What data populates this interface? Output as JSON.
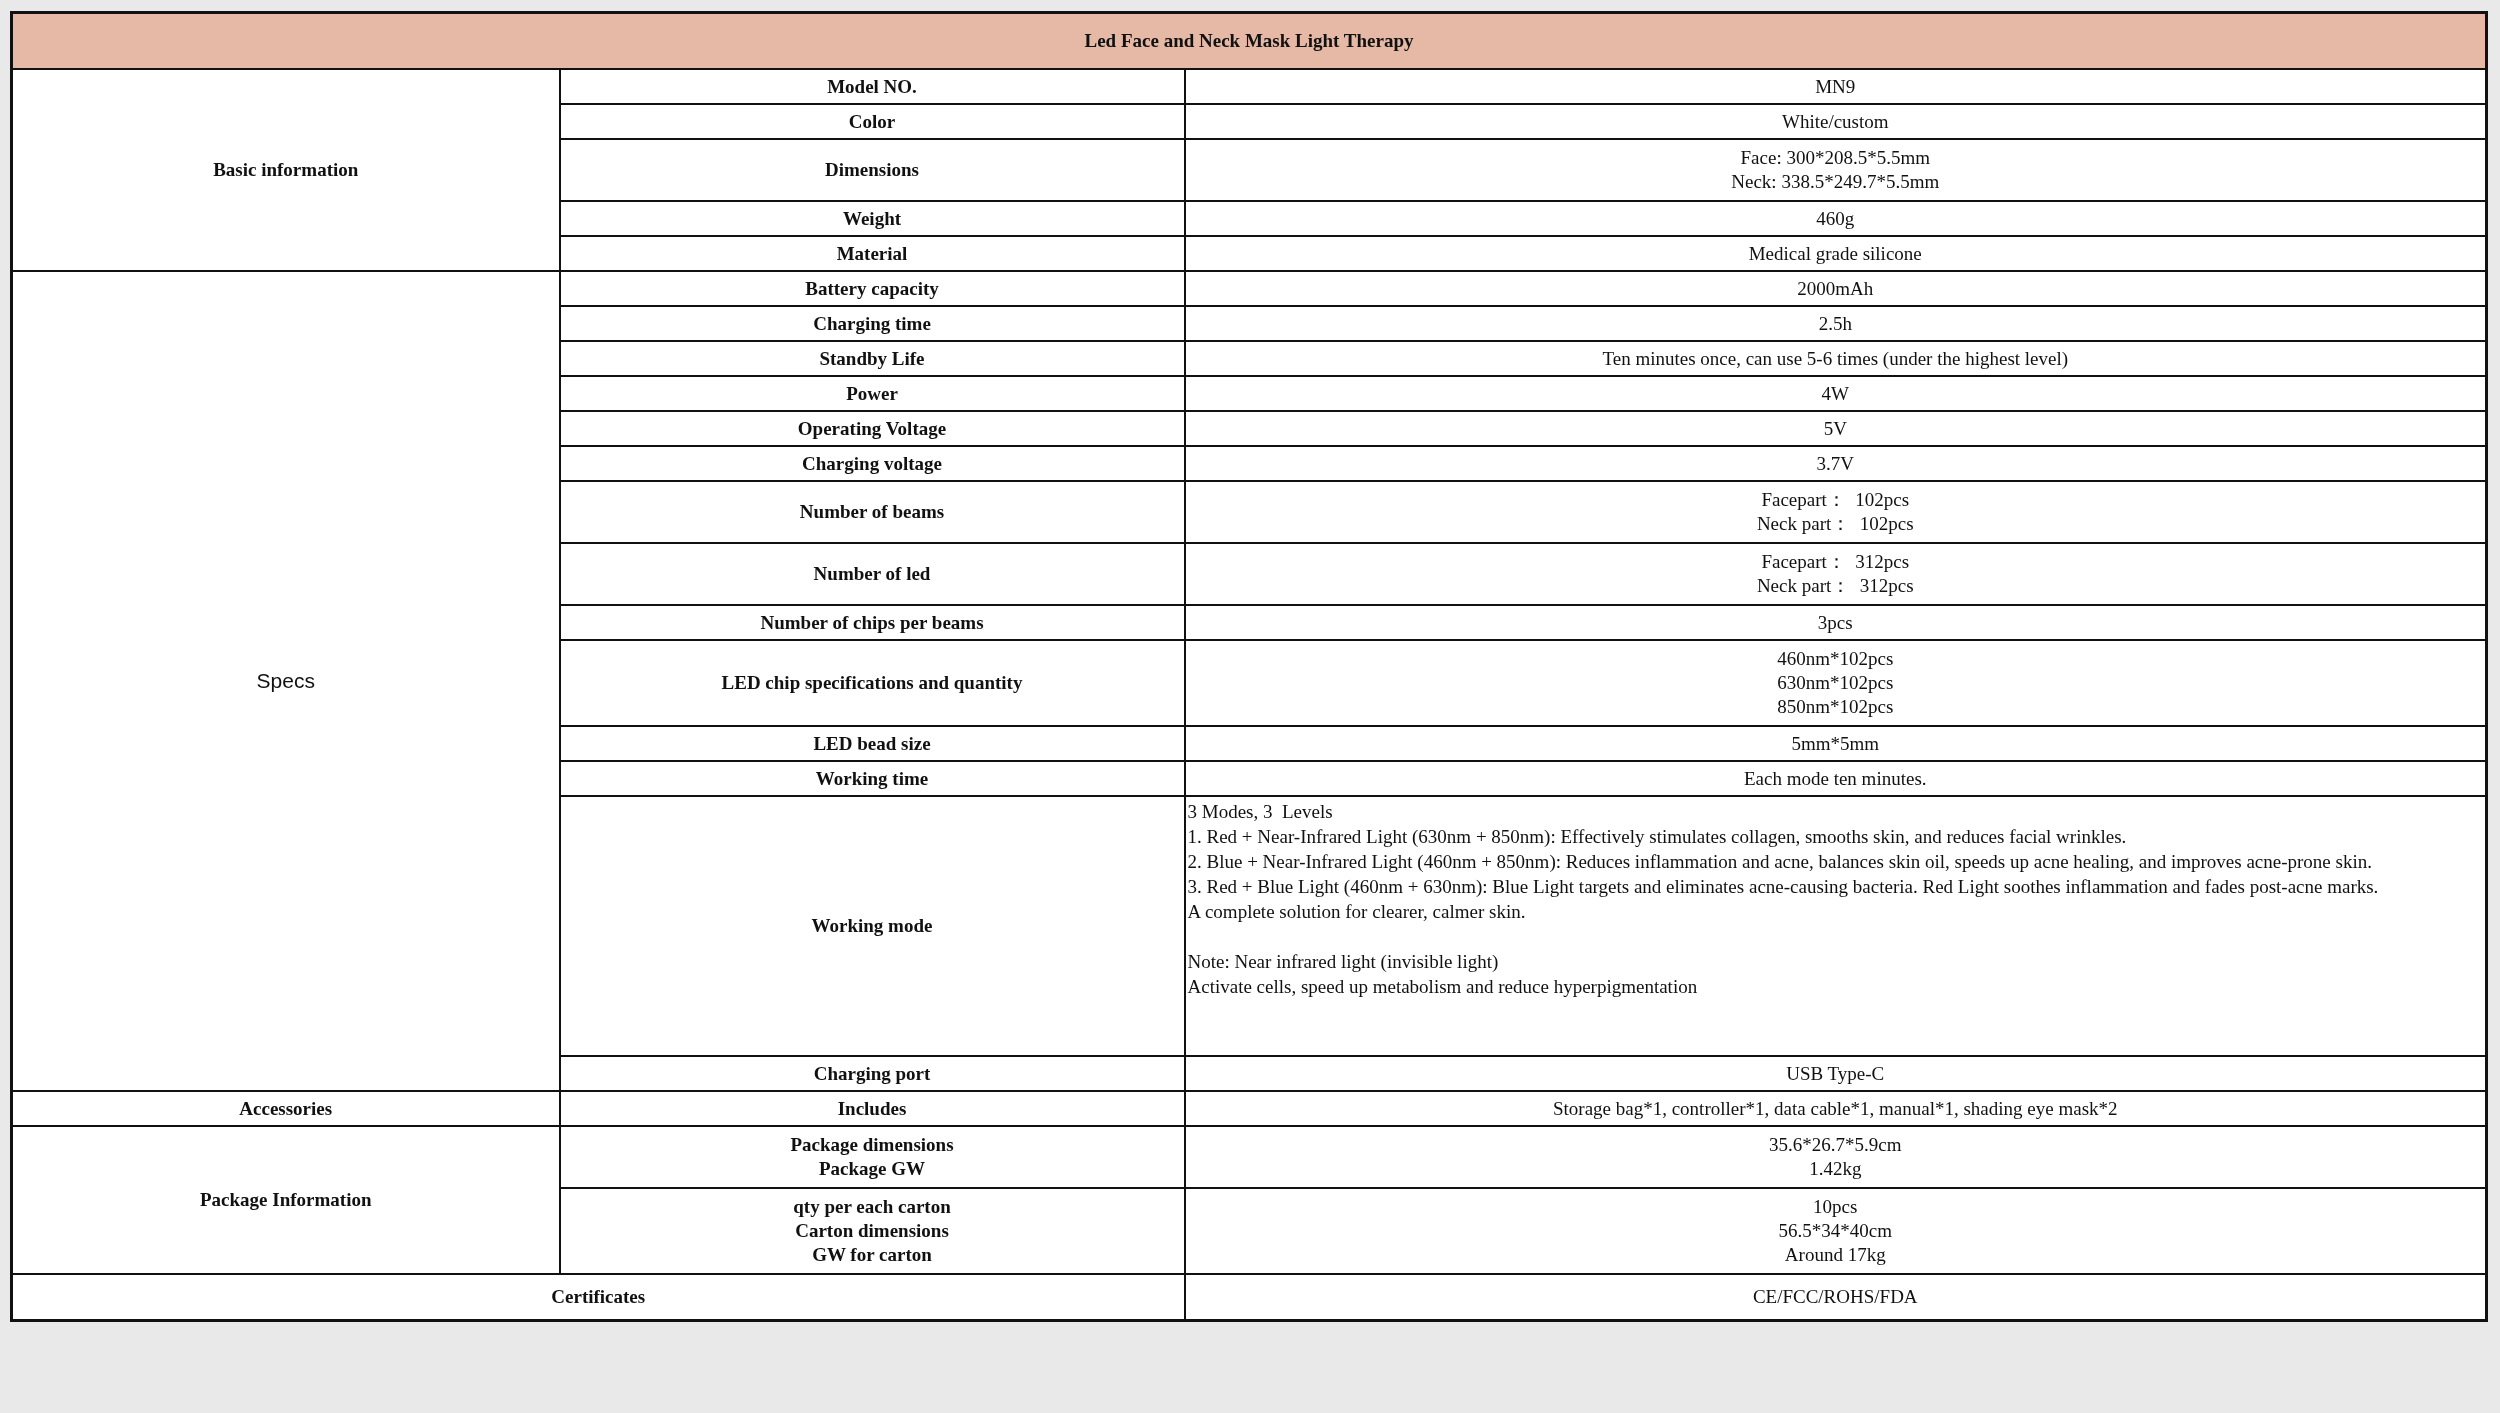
{
  "title": "Led Face and Neck Mask Light Therapy",
  "sections": [
    {
      "label": "Basic information",
      "kind": "bold",
      "rows": [
        {
          "label": [
            "Model NO."
          ],
          "value": [
            "MN9"
          ]
        },
        {
          "label": [
            "Color"
          ],
          "value": [
            "White/custom"
          ]
        },
        {
          "label": [
            "Dimensions"
          ],
          "value": [
            "Face: 300*208.5*5.5mm",
            "Neck: 338.5*249.7*5.5mm"
          ]
        },
        {
          "label": [
            "Weight"
          ],
          "value": [
            "460g"
          ]
        },
        {
          "label": [
            "Material"
          ],
          "value": [
            "Medical grade silicone"
          ]
        }
      ]
    },
    {
      "label": "Specs",
      "kind": "sans",
      "rows": [
        {
          "label": [
            "Battery capacity"
          ],
          "value": [
            "2000mAh"
          ]
        },
        {
          "label": [
            "Charging time"
          ],
          "value": [
            "2.5h"
          ]
        },
        {
          "label": [
            "Standby Life"
          ],
          "value": [
            "Ten minutes once, can use 5-6 times (under the highest level)"
          ]
        },
        {
          "label": [
            "Power"
          ],
          "value": [
            "4W"
          ]
        },
        {
          "label": [
            "Operating Voltage"
          ],
          "value": [
            "5V"
          ]
        },
        {
          "label": [
            "Charging voltage"
          ],
          "value": [
            "3.7V"
          ]
        },
        {
          "label": [
            "Number of beams"
          ],
          "value": [
            "Facepart：  102pcs",
            "Neck part：  102pcs"
          ]
        },
        {
          "label": [
            "Number of led"
          ],
          "value": [
            "Facepart：  312pcs",
            "Neck part：  312pcs"
          ]
        },
        {
          "label": [
            "Number of chips per beams"
          ],
          "value": [
            "3pcs"
          ]
        },
        {
          "label": [
            "LED chip specifications and quantity"
          ],
          "value": [
            "460nm*102pcs",
            "630nm*102pcs",
            "850nm*102pcs"
          ]
        },
        {
          "label": [
            "LED bead size"
          ],
          "value": [
            "5mm*5mm"
          ]
        },
        {
          "label": [
            "Working time"
          ],
          "value": [
            "Each mode ten minutes."
          ]
        },
        {
          "label": [
            "Working mode"
          ],
          "value": [
            "3 Modes, 3  Levels",
            "1. Red + Near-Infrared Light (630nm + 850nm): Effectively stimulates collagen, smooths skin, and reduces facial wrinkles.",
            "2. Blue + Near-Infrared Light (460nm + 850nm): Reduces inflammation and acne, balances skin oil, speeds up acne healing, and improves acne-prone skin.",
            "3. Red + Blue Light (460nm + 630nm): Blue Light targets and eliminates acne-causing bacteria. Red Light soothes inflammation and fades post-acne marks.",
            "A complete solution for clearer, calmer skin."
          ],
          "note": [
            "Note: Near infrared light (invisible light)",
            "Activate cells, speed up metabolism and reduce hyperpigmentation"
          ]
        },
        {
          "label": [
            "Charging port"
          ],
          "value": [
            "USB Type-C"
          ]
        }
      ]
    },
    {
      "label": "Accessories",
      "kind": "bold",
      "rows": [
        {
          "label": [
            "Includes"
          ],
          "value": [
            "Storage bag*1, controller*1, data cable*1, manual*1, shading eye mask*2"
          ]
        }
      ]
    },
    {
      "label": "Package Information",
      "kind": "bold",
      "rows": [
        {
          "label": [
            "Package dimensions",
            "Package GW"
          ],
          "value": [
            "35.6*26.7*5.9cm",
            "1.42kg"
          ]
        },
        {
          "label": [
            "qty per each carton",
            "Carton dimensions",
            "GW for carton"
          ],
          "value": [
            "10pcs",
            "56.5*34*40cm",
            "Around 17kg"
          ]
        }
      ]
    }
  ],
  "footer": {
    "label": "Certificates",
    "value": "CE/FCC/ROHS/FDA"
  }
}
